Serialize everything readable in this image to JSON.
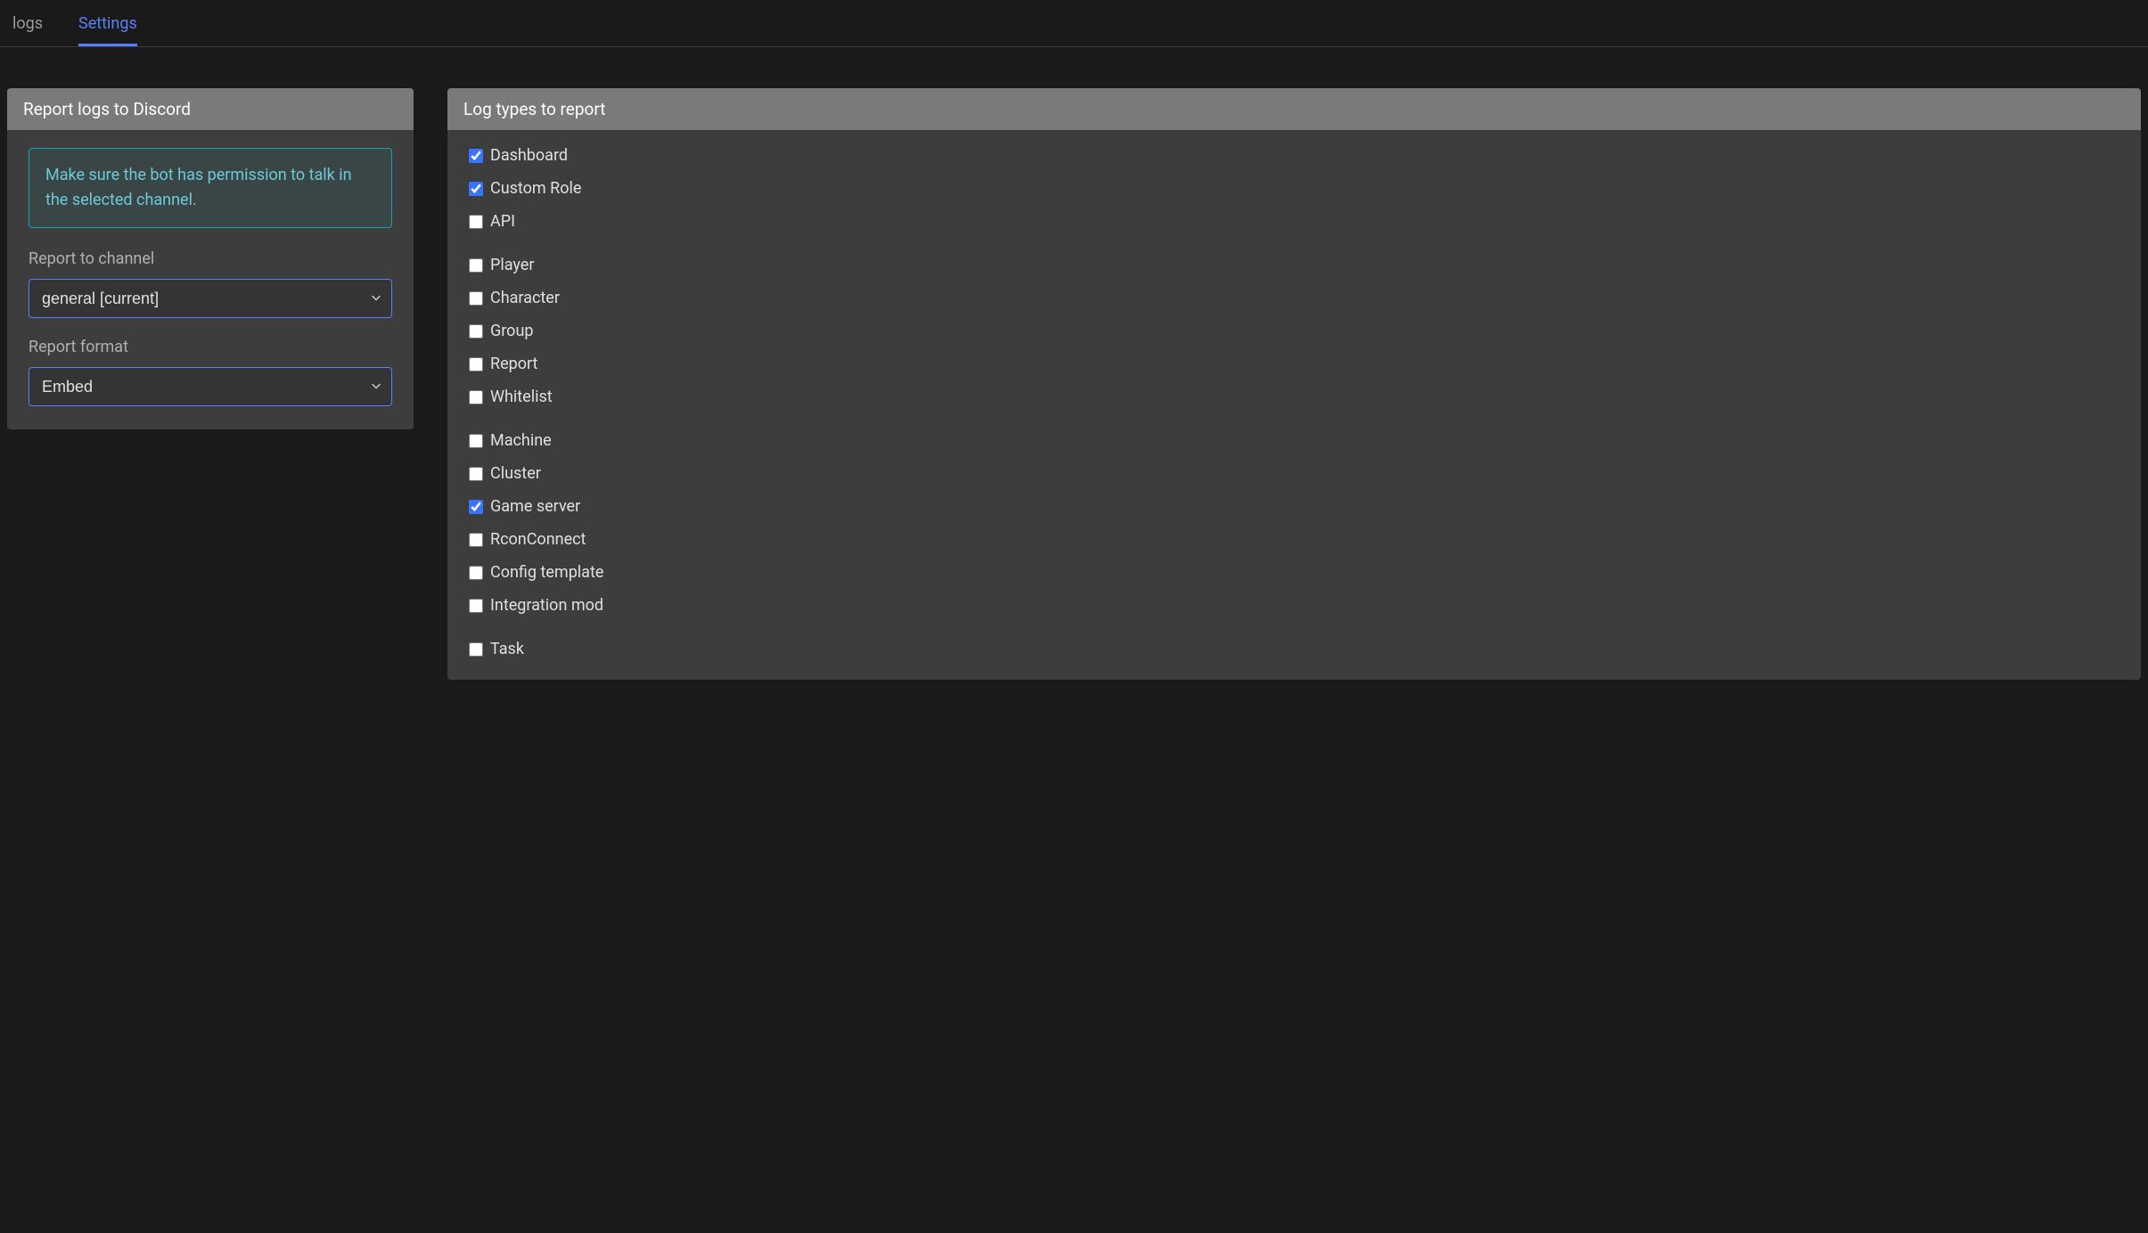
{
  "tabs": {
    "logs": {
      "label": "logs",
      "active": false
    },
    "settings": {
      "label": "Settings",
      "active": true
    }
  },
  "leftPanel": {
    "title": "Report logs to Discord",
    "info": "Make sure the bot has permission to talk in the selected channel.",
    "channel": {
      "label": "Report to channel",
      "selected": "general [current]"
    },
    "format": {
      "label": "Report format",
      "selected": "Embed"
    }
  },
  "rightPanel": {
    "title": "Log types to report",
    "groups": [
      [
        {
          "label": "Dashboard",
          "checked": true
        },
        {
          "label": "Custom Role",
          "checked": true
        },
        {
          "label": "API",
          "checked": false
        }
      ],
      [
        {
          "label": "Player",
          "checked": false
        },
        {
          "label": "Character",
          "checked": false
        },
        {
          "label": "Group",
          "checked": false
        },
        {
          "label": "Report",
          "checked": false
        },
        {
          "label": "Whitelist",
          "checked": false
        }
      ],
      [
        {
          "label": "Machine",
          "checked": false
        },
        {
          "label": "Cluster",
          "checked": false
        },
        {
          "label": "Game server",
          "checked": true
        },
        {
          "label": "RconConnect",
          "checked": false
        },
        {
          "label": "Config template",
          "checked": false
        },
        {
          "label": "Integration mod",
          "checked": false
        }
      ],
      [
        {
          "label": "Task",
          "checked": false
        }
      ]
    ]
  }
}
